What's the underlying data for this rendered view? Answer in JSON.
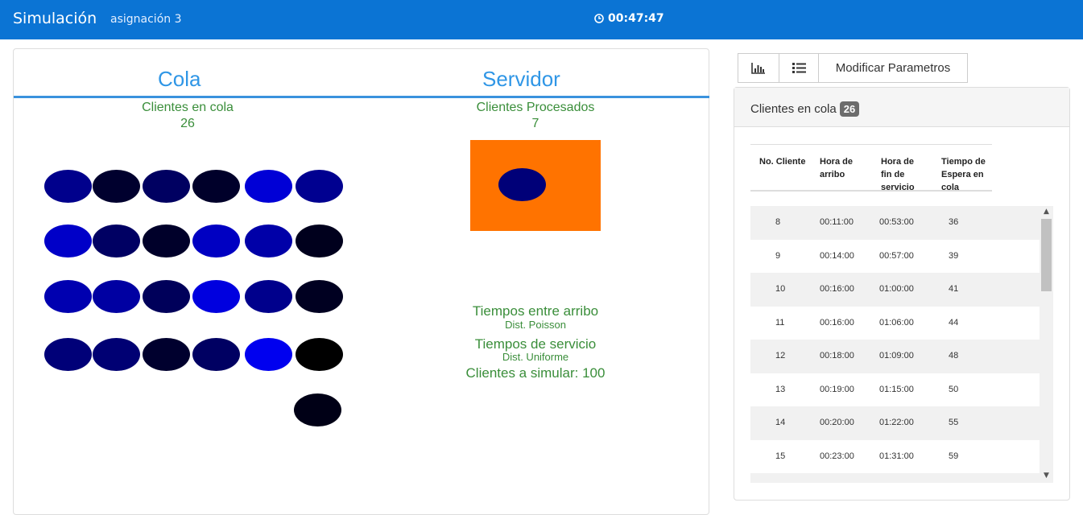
{
  "navbar": {
    "brand": "Simulación",
    "subtitle": "asignación 3",
    "timer": "00:47:47"
  },
  "cola": {
    "title": "Cola",
    "clients_label": "Clientes en cola",
    "clients_value": "26",
    "balls": [
      "#00008c",
      "#00002e",
      "#000061",
      "#00002a",
      "#0000d6",
      "#000090",
      "#0000c8",
      "#000063",
      "#00002a",
      "#0000c2",
      "#0000a8",
      "#00001d",
      "#0000b0",
      "#0000a2",
      "#00005a",
      "#0000df",
      "#00008c",
      "#000021",
      "#000078",
      "#000073",
      "#00002e",
      "#000062",
      "#0000ef",
      "#000000",
      "#000016"
    ]
  },
  "servidor": {
    "title": "Servidor",
    "processed_label": "Clientes Procesados",
    "processed_value": "7",
    "server_ball_color": "#000078",
    "arrival_label": "Tiempos entre arribo",
    "arrival_dist": "Dist. Poisson",
    "service_label": "Tiempos de servicio",
    "service_dist": "Dist. Uniforme",
    "simulate_label": "Clientes a simular: 100"
  },
  "buttons": {
    "chart_icon": "bar-chart-icon",
    "list_icon": "list-icon",
    "modify_label": "Modificar Parametros"
  },
  "queue_table": {
    "heading": "Clientes en cola",
    "badge": "26",
    "headers": [
      "No. Cliente",
      "Hora de arribo",
      "Hora de fin de servicio",
      "Tiempo de Espera en cola"
    ],
    "rows": [
      [
        "8",
        "00:11:00",
        "00:53:00",
        "36"
      ],
      [
        "9",
        "00:14:00",
        "00:57:00",
        "39"
      ],
      [
        "10",
        "00:16:00",
        "01:00:00",
        "41"
      ],
      [
        "11",
        "00:16:00",
        "01:06:00",
        "44"
      ],
      [
        "12",
        "00:18:00",
        "01:09:00",
        "48"
      ],
      [
        "13",
        "00:19:00",
        "01:15:00",
        "50"
      ],
      [
        "14",
        "00:20:00",
        "01:22:00",
        "55"
      ],
      [
        "15",
        "00:23:00",
        "01:31:00",
        "59"
      ]
    ]
  }
}
